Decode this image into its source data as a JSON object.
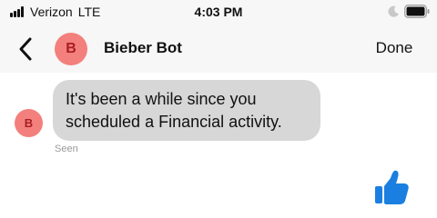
{
  "status_bar": {
    "carrier": "Verizon",
    "network": "LTE",
    "time": "4:03 PM",
    "icons": [
      "signal-icon",
      "moon-icon",
      "battery-icon"
    ]
  },
  "header": {
    "avatar_initial": "B",
    "contact_name": "Bieber Bot",
    "done_label": "Done",
    "back_icon": "chevron-left-icon"
  },
  "messages": [
    {
      "sender_initial": "B",
      "text": "It's been a while since you scheduled a Financial activity.",
      "status": "Seen"
    }
  ],
  "composer": {
    "like_icon": "thumbs-up-icon"
  },
  "colors": {
    "avatar_bg": "#f3807c",
    "avatar_text": "#a81e22",
    "bubble_bg": "#d7d7d7",
    "like_blue": "#1a7fe0",
    "header_bg": "#f7f7f7"
  }
}
